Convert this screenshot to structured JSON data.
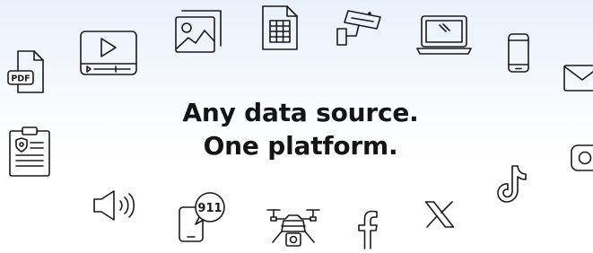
{
  "headline": {
    "line1": "Any data source.",
    "line2": "One platform."
  },
  "badges": {
    "pdf": "PDF",
    "emergency": "911"
  },
  "icons": [
    "pdf-file-icon",
    "video-player-icon",
    "image-icon",
    "spreadsheet-icon",
    "security-camera-icon",
    "laptop-icon",
    "smartphone-icon",
    "email-icon",
    "police-report-icon",
    "speaker-icon",
    "emergency-call-icon",
    "drone-icon",
    "facebook-icon",
    "x-icon",
    "tiktok-icon",
    "instagram-icon"
  ]
}
